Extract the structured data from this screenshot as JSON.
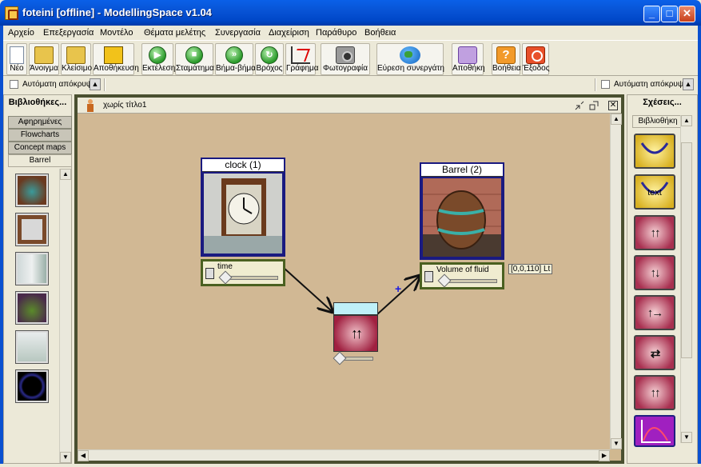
{
  "window": {
    "title": "foteini [offline] - ModellingSpace v1.04",
    "min_glyph": "_",
    "max_glyph": "□",
    "close_glyph": "✕"
  },
  "menu": [
    "Αρχείο",
    "Επεξεργασία",
    "Μοντέλο",
    "Θέματα μελέτης",
    "Συνεργασία",
    "Διαχείριση",
    "Παράθυρο",
    "Βοήθεια"
  ],
  "toolbar": {
    "new": "Νέο",
    "open": "Άνοιγμα",
    "close": "Κλείσιμο",
    "save": "Αποθήκευση",
    "run": "Εκτέλεση",
    "stop": "Σταμάτημα",
    "step": "Βήμα-βήμα",
    "loop": "Βρόχος",
    "graph": "Γράφημα",
    "photo": "Φωτογραφία",
    "find_partner": "Εύρεση συνεργάτη",
    "store": "Αποθήκη",
    "help": "Βοήθεια",
    "exit": "Έξοδος"
  },
  "options": {
    "auto_hide_left": "Αυτόματη απόκρυψη",
    "auto_hide_right": "Αυτόματη απόκρυψη"
  },
  "left_panel": {
    "title": "Βιβλιοθήκες...",
    "tabs": [
      "Αφηρημένες",
      "Flowcharts",
      "Concept maps",
      "Barrel"
    ],
    "active_tab": "Barrel",
    "thumbnails": [
      "barrel",
      "clock",
      "lab-equipment",
      "plant",
      "lab-flask",
      "dark-ring"
    ]
  },
  "canvas": {
    "window_title": "χωρίς τίτλο1",
    "nodes": [
      {
        "title": "clock (1)",
        "variable": "time"
      },
      {
        "title": "Barrel (2)",
        "variable": "Volume of fluid",
        "range": "[0,0,110] Lt"
      }
    ],
    "relation": {
      "symbol": "↑↑",
      "plus_sign": "+"
    }
  },
  "right_panel": {
    "title": "Σχέσεις...",
    "tab": "Βιβλιοθήκη",
    "relations": [
      {
        "type": "curve",
        "label": ""
      },
      {
        "type": "text",
        "label": "text"
      },
      {
        "type": "up-up",
        "label": "↑↑"
      },
      {
        "type": "up-down",
        "label": "↑↓"
      },
      {
        "type": "up-right",
        "label": "↑→"
      },
      {
        "type": "swap",
        "label": "⇄"
      },
      {
        "type": "up-up-small",
        "label": "↑↑"
      },
      {
        "type": "graph",
        "label": ""
      }
    ]
  },
  "colors": {
    "canvas_bg": "#d1b894",
    "node_border": "#1a1a80",
    "variable_border": "#4a6020",
    "title_bar": "#0854d6"
  }
}
